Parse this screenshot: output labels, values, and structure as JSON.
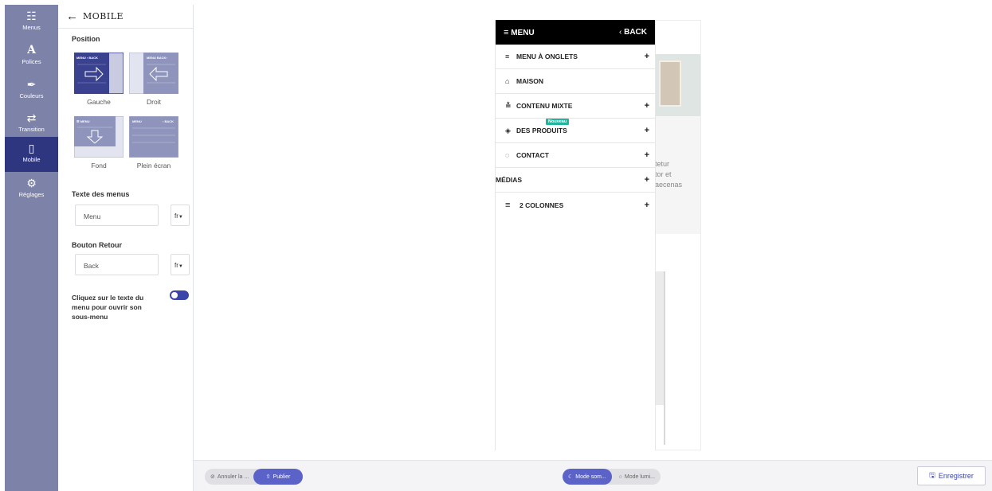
{
  "rail": {
    "items": [
      {
        "label": "Menus",
        "icon": "grid-icon"
      },
      {
        "label": "Polices",
        "icon": "font-icon"
      },
      {
        "label": "Couleurs",
        "icon": "brush-icon"
      },
      {
        "label": "Transition",
        "icon": "shuffle-icon"
      },
      {
        "label": "Mobile",
        "icon": "mobile-icon"
      },
      {
        "label": "Réglages",
        "icon": "gear-icon"
      }
    ]
  },
  "panel": {
    "title": "MOBILE",
    "position_label": "Position",
    "positions": [
      {
        "label": "Gauche",
        "thumb_menu": "MENU",
        "thumb_back": "‹ BACK"
      },
      {
        "label": "Droit",
        "thumb_menu": "MENU",
        "thumb_back": "BACK ›"
      },
      {
        "label": "Fond",
        "thumb_menu": "MENU"
      },
      {
        "label": "Plein écran",
        "thumb_menu": "MENU",
        "thumb_back": "‹ BACK"
      }
    ],
    "menu_text_label": "Texte des menus",
    "menu_text_value": "Menu",
    "menu_text_lang": "fr",
    "back_label": "Bouton Retour",
    "back_value": "Back",
    "back_lang": "fr",
    "toggle_text": "Cliquez sur le texte du menu pour ouvrir son sous-menu"
  },
  "mobile_menu": {
    "menu_title": "MENU",
    "back": "BACK",
    "items": [
      {
        "label": "MENU À ONGLETS",
        "icon": "≡",
        "expand": "+"
      },
      {
        "label": "MAISON",
        "icon": "⌂",
        "expand": ""
      },
      {
        "label": "CONTENU MIXTE",
        "icon": "≛",
        "expand": "+"
      },
      {
        "label": "DES PRODUITS",
        "icon": "◈",
        "expand": "+",
        "badge": "Nouveau"
      },
      {
        "label": "CONTACT",
        "icon": "◌",
        "expand": "+"
      },
      {
        "label": "MÉDIAS",
        "icon": "",
        "expand": "+"
      },
      {
        "label": "2 COLONNES",
        "icon": "≡",
        "expand": "+"
      }
    ]
  },
  "preview_text": [
    "tetur",
    "tor et",
    "aecenas"
  ],
  "bottom": {
    "undo": "Annuler la ...",
    "publish": "Publier",
    "dark_mode": "Mode som...",
    "light_mode": "Mode lumi...",
    "save": "Enregistrer"
  }
}
